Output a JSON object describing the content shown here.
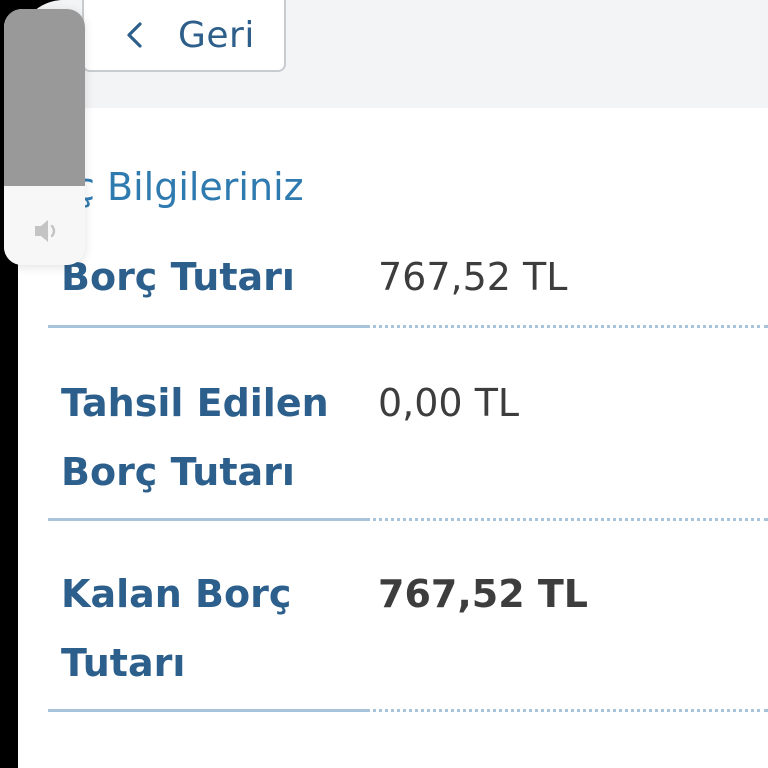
{
  "nav": {
    "back_label": "Geri",
    "back_icon": "chevron-left-icon"
  },
  "section": {
    "title": "orç Bilgileriniz"
  },
  "debt_rows": [
    {
      "label": "Borç Tutarı",
      "value": "767,52 TL",
      "emphasis": false
    },
    {
      "label": "Tahsil Edilen Borç Tutarı",
      "value": "0,00 TL",
      "emphasis": false
    },
    {
      "label": "Kalan Borç Tutarı",
      "value": "767,52 TL",
      "emphasis": true
    }
  ],
  "volume_hud": {
    "level_percent": 69,
    "icon": "speaker-icon"
  },
  "colors": {
    "primary_text": "#2c5f8c",
    "section_title": "#2f7bb0",
    "value_text": "#3d3d3d",
    "divider": "#a8c4dd",
    "header_band": "#f3f4f5"
  }
}
